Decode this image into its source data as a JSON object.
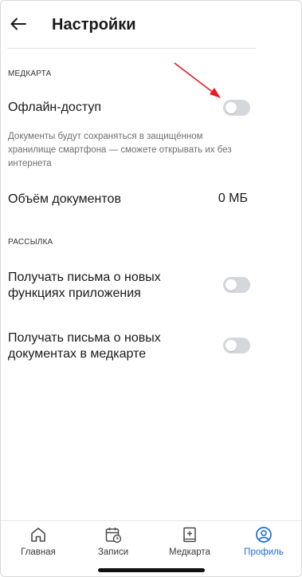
{
  "header": {
    "title": "Настройки",
    "back_icon": "arrow-left-icon"
  },
  "medcard": {
    "section_label": "МЕДКАРТА",
    "offline_label": "Офлайн-доступ",
    "offline_enabled": false,
    "offline_hint": "Документы будут сохраняться в защищённом хранилище смартфона — сможете открывать их без интернета",
    "docs_size_label": "Объём документов",
    "docs_size_value": "0 МБ"
  },
  "mailing": {
    "section_label": "РАССЫЛКА",
    "features_label": "Получать письма о новых функциях приложения",
    "features_enabled": false,
    "documents_label": "Получать письма о новых документах в медкарте",
    "documents_enabled": false
  },
  "tabbar": {
    "tabs": [
      {
        "label": "Главная",
        "icon": "home-icon",
        "active": false
      },
      {
        "label": "Записи",
        "icon": "calendar-clock-icon",
        "active": false
      },
      {
        "label": "Медкарта",
        "icon": "medical-book-icon",
        "active": false
      },
      {
        "label": "Профиль",
        "icon": "profile-icon",
        "active": true
      }
    ]
  },
  "colors": {
    "accent": "#1a6fd6",
    "toggle_off": "#d4d7dc",
    "annotation_arrow": "#e8191f"
  }
}
